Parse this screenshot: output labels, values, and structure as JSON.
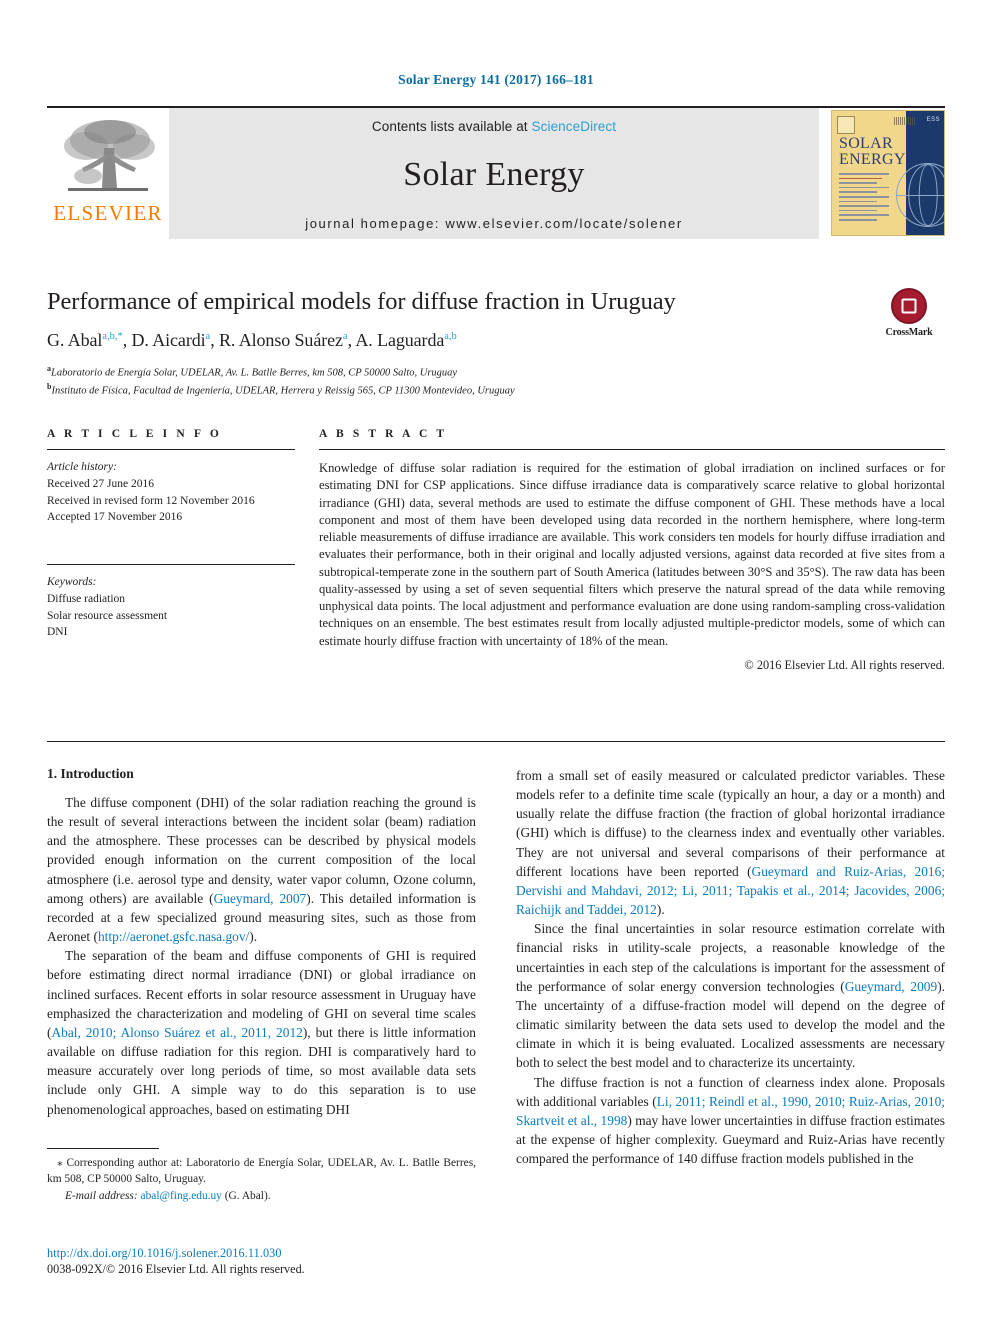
{
  "running_head": "Solar Energy 141 (2017) 166–181",
  "masthead": {
    "publisher_logo_label": "ELSEVIER",
    "contents_prefix": "Contents lists available at ",
    "contents_link": "ScienceDirect",
    "journal_name": "Solar Energy",
    "homepage": "journal homepage: www.elsevier.com/locate/solener",
    "cover": {
      "title_line1": "SOLAR",
      "title_line2": "ENERGY",
      "imprint": "ESS"
    }
  },
  "article": {
    "title": "Performance of empirical models for diffuse fraction in Uruguay",
    "authors": [
      {
        "name": "G. Abal",
        "marks": "a,b,*"
      },
      {
        "name": "D. Aicardi",
        "marks": "a"
      },
      {
        "name": "R. Alonso Suárez",
        "marks": "a"
      },
      {
        "name": "A. Laguarda",
        "marks": "a,b"
      }
    ],
    "affiliations": [
      {
        "mark": "a",
        "text": "Laboratorio de Energía Solar, UDELAR, Av. L. Batlle Berres, km 508, CP 50000 Salto, Uruguay"
      },
      {
        "mark": "b",
        "text": "Instituto de Física, Facultad de Ingeniería, UDELAR, Herrera y Reissig 565, CP 11300 Montevideo, Uruguay"
      }
    ],
    "crossmark_label": "CrossMark"
  },
  "info": {
    "heading": "A R T I C L E   I N F O",
    "history_label": "Article history:",
    "history": [
      "Received 27 June 2016",
      "Received in revised form 12 November 2016",
      "Accepted 17 November 2016"
    ],
    "keywords_label": "Keywords:",
    "keywords": [
      "Diffuse radiation",
      "Solar resource assessment",
      "DNI"
    ]
  },
  "abstract": {
    "heading": "A B S T R A C T",
    "text": "Knowledge of diffuse solar radiation is required for the estimation of global irradiation on inclined surfaces or for estimating DNI for CSP applications. Since diffuse irradiance data is comparatively scarce relative to global horizontal irradiance (GHI) data, several methods are used to estimate the diffuse component of GHI. These methods have a local component and most of them have been developed using data recorded in the northern hemisphere, where long-term reliable measurements of diffuse irradiance are available. This work considers ten models for hourly diffuse irradiation and evaluates their performance, both in their original and locally adjusted versions, against data recorded at five sites from a subtropical-temperate zone in the southern part of South America (latitudes between 30°S and 35°S). The raw data has been quality-assessed by using a set of seven sequential filters which preserve the natural spread of the data while removing unphysical data points. The local adjustment and performance evaluation are done using random-sampling cross-validation techniques on an ensemble. The best estimates result from locally adjusted multiple-predictor models, some of which can estimate hourly diffuse fraction with uncertainty of 18% of the mean.",
    "copyright": "© 2016 Elsevier Ltd. All rights reserved."
  },
  "body": {
    "section_number_title": "1. Introduction",
    "left_paragraphs": [
      {
        "parts": [
          {
            "t": "The diffuse component (DHI) of the solar radiation reaching the ground is the result of several interactions between the incident solar (beam) radiation and the atmosphere. These processes can be described by physical models provided enough information on the current composition of the local atmosphere (i.e. aerosol type and density, water vapor column, Ozone column, among others) are available (",
            "k": "text"
          },
          {
            "t": "Gueymard, 2007",
            "k": "ref"
          },
          {
            "t": "). This detailed information is recorded at a few specialized ground measuring sites, such as those from Aeronet (",
            "k": "text"
          },
          {
            "t": "http://aeronet.gsfc.nasa.gov/",
            "k": "url"
          },
          {
            "t": ").",
            "k": "text"
          }
        ]
      },
      {
        "parts": [
          {
            "t": "The separation of the beam and diffuse components of GHI is required before estimating direct normal irradiance (DNI) or global irradiance on inclined surfaces. Recent efforts in solar resource assessment in Uruguay have emphasized the characterization and modeling of GHI on several time scales (",
            "k": "text"
          },
          {
            "t": "Abal, 2010; Alonso Suárez et al., 2011, 2012",
            "k": "ref"
          },
          {
            "t": "), but there is little information available on diffuse radiation for this region. DHI is comparatively hard to measure accurately over long periods of time, so most available data sets include only GHI. A simple way to do this separation is to use phenomenological approaches, based on estimating DHI",
            "k": "text"
          }
        ]
      }
    ],
    "right_paragraphs": [
      {
        "indent": false,
        "parts": [
          {
            "t": "from a small set of easily measured or calculated predictor variables. These models refer to a definite time scale (typically an hour, a day or a month) and usually relate the diffuse fraction (the fraction of global horizontal irradiance (GHI) which is diffuse) to the clearness index and eventually other variables. They are not universal and several comparisons of their performance at different locations have been reported (",
            "k": "text"
          },
          {
            "t": "Gueymard and Ruiz-Arias, 2016; Dervishi and Mahdavi, 2012; Li, 2011; Tapakis et al., 2014; Jacovides, 2006; Raichijk and Taddei, 2012",
            "k": "ref"
          },
          {
            "t": ").",
            "k": "text"
          }
        ]
      },
      {
        "indent": true,
        "parts": [
          {
            "t": "Since the final uncertainties in solar resource estimation correlate with financial risks in utility-scale projects, a reasonable knowledge of the uncertainties in each step of the calculations is important for the assessment of the performance of solar energy conversion technologies (",
            "k": "text"
          },
          {
            "t": "Gueymard, 2009",
            "k": "ref"
          },
          {
            "t": "). The uncertainty of a diffuse-fraction model will depend on the degree of climatic similarity between the data sets used to develop the model and the climate in which it is being evaluated. Localized assessments are necessary both to select the best model and to characterize its uncertainty.",
            "k": "text"
          }
        ]
      },
      {
        "indent": true,
        "parts": [
          {
            "t": "The diffuse fraction is not a function of clearness index alone. Proposals with additional variables (",
            "k": "text"
          },
          {
            "t": "Li, 2011; Reindl et al., 1990, 2010; Ruiz-Arias, 2010; Skartveit et al., 1998",
            "k": "ref"
          },
          {
            "t": ") may have lower uncertainties in diffuse fraction estimates at the expense of higher complexity. Gueymard and Ruiz-Arias have recently compared the performance of 140 diffuse fraction models published in the",
            "k": "text"
          }
        ]
      }
    ]
  },
  "footnote": {
    "marker": "⁎",
    "text": "Corresponding author at: Laboratorio de Energía Solar, UDELAR, Av. L. Batlle Berres, km 508, CP 50000 Salto, Uruguay.",
    "email_label": "E-mail address:",
    "email": "abal@fing.edu.uy",
    "email_suffix": "(G. Abal)."
  },
  "footer": {
    "doi": "http://dx.doi.org/10.1016/j.solener.2016.11.030",
    "issn_line": "0038-092X/© 2016 Elsevier Ltd. All rights reserved."
  },
  "colors": {
    "link": "#0b7abf",
    "elsevier_orange": "#F07D00",
    "crossmark_red": "#a51c30",
    "banner_gray": "#e6e6e6"
  }
}
